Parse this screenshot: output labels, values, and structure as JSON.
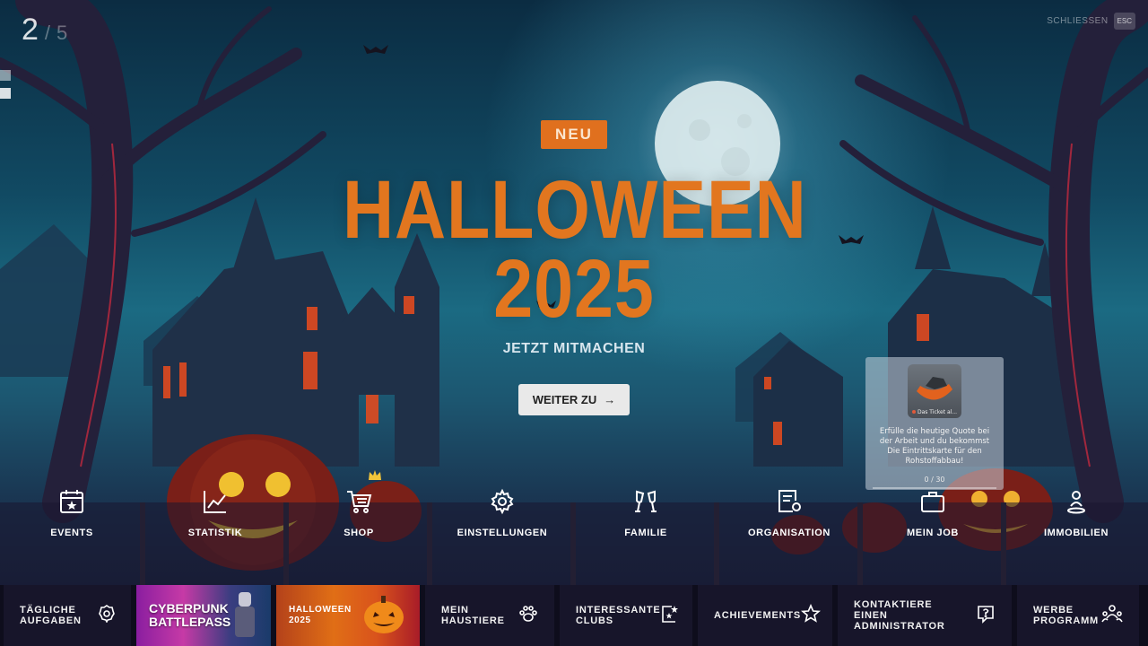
{
  "slide": {
    "current": "2",
    "separator": "/",
    "total": "5"
  },
  "close": {
    "label": "SCHLIESSEN",
    "key": "ESC"
  },
  "hero": {
    "badge": "NEU",
    "title_line1": "HALLOWEEN",
    "title_line2": "2025",
    "subtitle": "JETZT MITMACHEN",
    "cta_label": "WEITER ZU",
    "cta_arrow": "→"
  },
  "task_card": {
    "thumb_label": "Das Ticket al...",
    "description": "Erfülle die heutige Quote bei der Arbeit und du bekommst Die Eintrittskarte für den Rohstoffabbau!",
    "progress_text": "0 / 30",
    "progress_value": 0
  },
  "nav": {
    "items": [
      {
        "label": "EVENTS",
        "icon": "calendar-star-icon"
      },
      {
        "label": "STATISTIK",
        "icon": "line-chart-icon"
      },
      {
        "label": "SHOP",
        "icon": "cart-icon"
      },
      {
        "label": "EINSTELLUNGEN",
        "icon": "gear-icon"
      },
      {
        "label": "FAMILIE",
        "icon": "glasses-toast-icon"
      },
      {
        "label": "ORGANISATION",
        "icon": "document-badge-icon"
      },
      {
        "label": "MEIN JOB",
        "icon": "briefcase-icon"
      },
      {
        "label": "IMMOBILIEN",
        "icon": "person-pin-icon"
      }
    ]
  },
  "bottom_bar": {
    "daily": {
      "line1": "TÄGLICHE",
      "line2": "AUFGABEN",
      "icon": "badge-icon"
    },
    "cyberpunk": {
      "line1": "CYBERPUNK",
      "line2": "BATTLEPASS"
    },
    "halloween": {
      "line1": "HALLOWEEN",
      "line2": "2025"
    },
    "pets": {
      "line1": "MEIN",
      "line2": "HAUSTIERE",
      "icon": "paw-icon"
    },
    "clubs": {
      "line1": "INTERESSANTE",
      "line2": "CLUBS",
      "icon": "star-book-icon"
    },
    "achievements": {
      "line1": "ACHIEVEMENTS",
      "icon": "star-icon"
    },
    "admin": {
      "line1": "KONTAKTIERE",
      "line2": "EINEN ADMINISTRATOR",
      "icon": "question-icon"
    },
    "referral": {
      "line1": "WERBE",
      "line2": "PROGRAMM",
      "icon": "people-icon"
    }
  },
  "colors": {
    "accent": "#e2761f",
    "bar": "#17152a"
  }
}
